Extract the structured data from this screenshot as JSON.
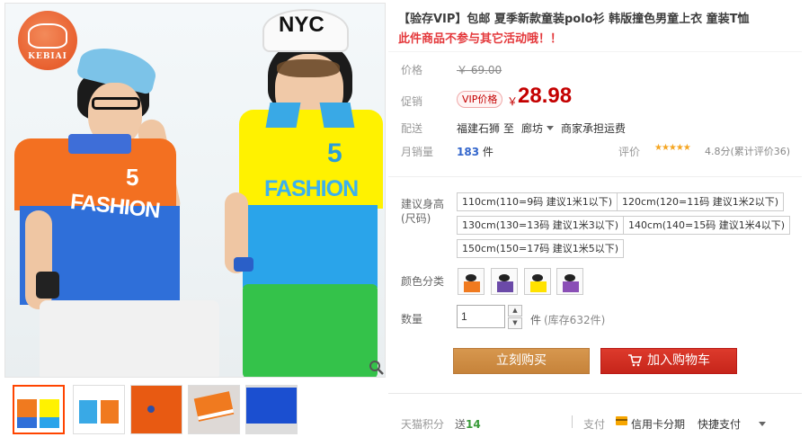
{
  "product": {
    "title": "【验存VIP】包邮 夏季新款童装polo衫 韩版撞色男童上衣 童装T恤",
    "notice": "此件商品不参与其它活动哦！！",
    "brand_logo_text": "KEBIAI",
    "shirt_word": "FASHION",
    "shirt_number": "5",
    "cap_text": "NYC"
  },
  "price": {
    "label": "价格",
    "original": "￥ 69.00"
  },
  "promo": {
    "label": "促销",
    "tag": "VIP价格",
    "currency": "￥",
    "value": "28.98"
  },
  "delivery": {
    "label": "配送",
    "from": "福建石狮",
    "to_word": "至",
    "destination": "廊坊",
    "shipping_note": "商家承担运费"
  },
  "sales": {
    "label": "月销量",
    "count": "183",
    "unit": "件",
    "rating_label": "评价",
    "stars": "★★★★★",
    "rating_text": "4.8分(累计评价36)"
  },
  "sizes": {
    "label": "建议身高(尺码)",
    "options": [
      "110cm(110=9码 建议1米1以下)",
      "120cm(120=11码 建议1米2以下)",
      "130cm(130=13码 建议1米3以下)",
      "140cm(140=15码 建议1米4以下)",
      "150cm(150=17码 建议1米5以下)"
    ]
  },
  "colors": {
    "label": "颜色分类",
    "swatch_colors": [
      "#f07a1f",
      "#6b4aa8",
      "#ffe200",
      "#8a4fb6"
    ]
  },
  "quantity": {
    "label": "数量",
    "value": "1",
    "unit": "件",
    "stock": "(库存632件)",
    "up_icon": "▲",
    "down_icon": "▼"
  },
  "actions": {
    "buy_now": "立刻购买",
    "add_to_cart": "加入购物车"
  },
  "footer": {
    "points_label": "天猫积分",
    "points_prefix": "送",
    "points_value": "14",
    "payment_label": "支付",
    "credit_installment": "信用卡分期",
    "quick_pay": "快捷支付"
  },
  "theme": {
    "accent": "#c40000",
    "buy_color": "#c6833a",
    "cart_color": "#c6251a"
  }
}
